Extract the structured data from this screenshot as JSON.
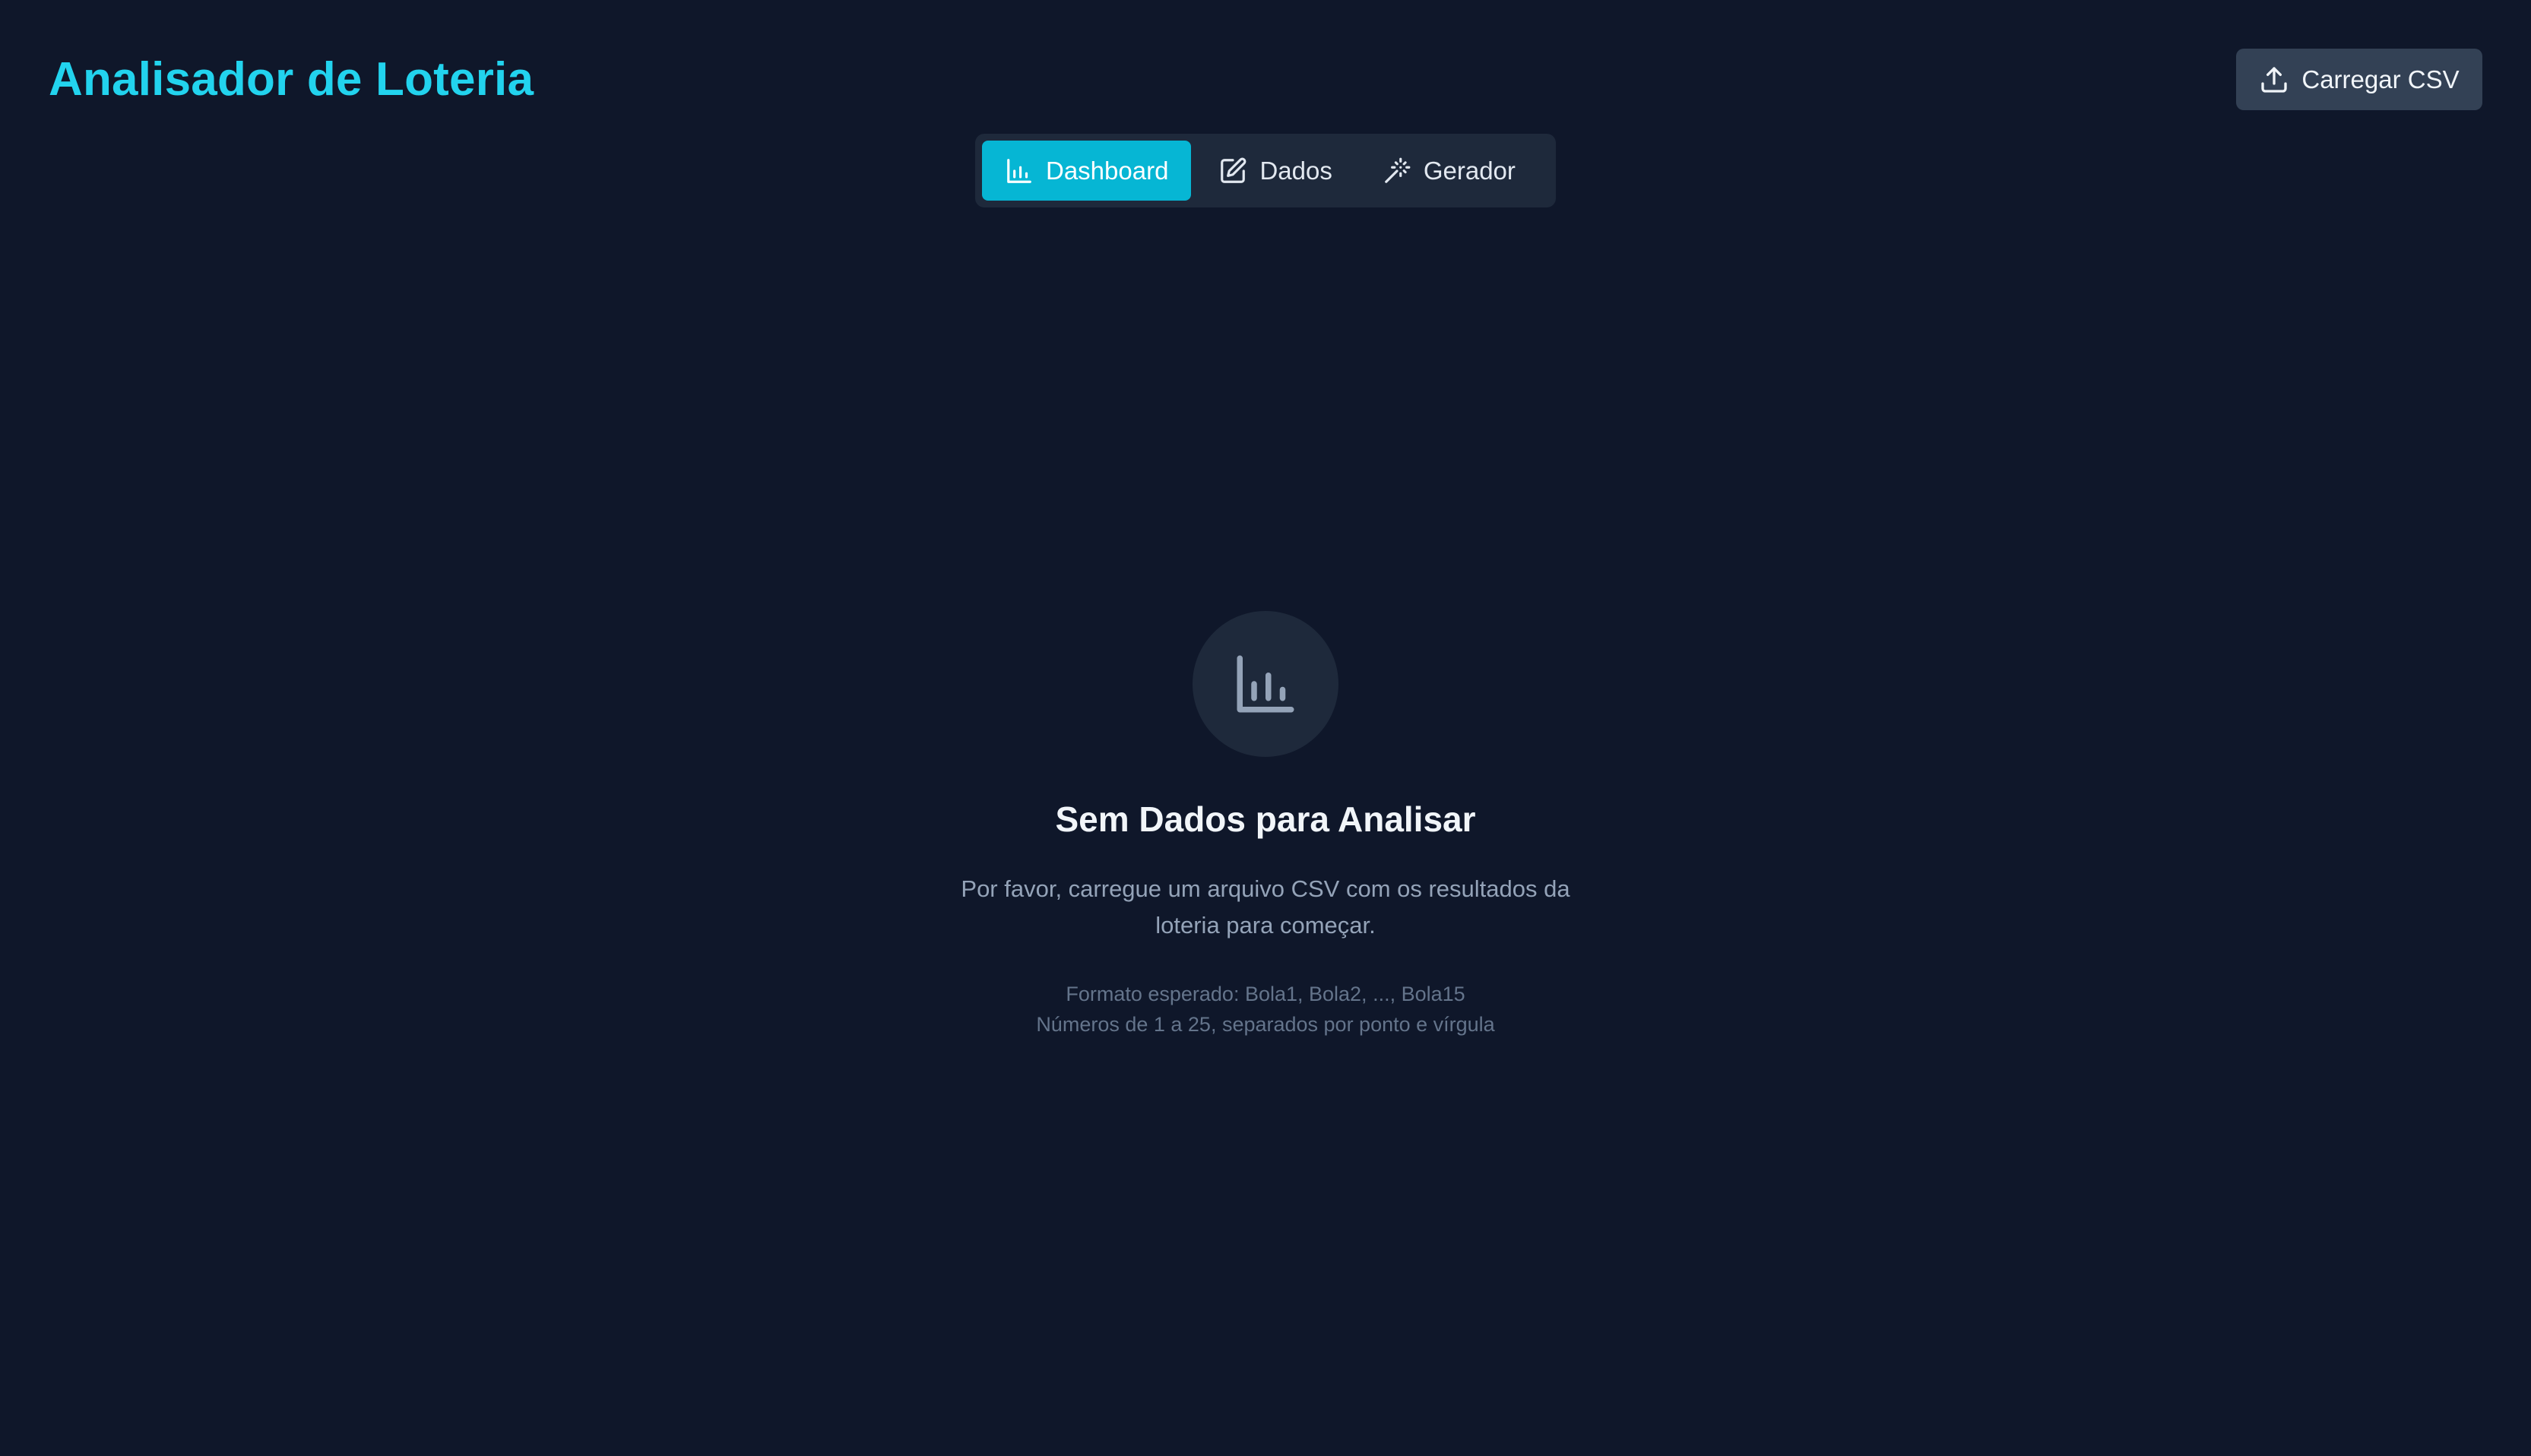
{
  "header": {
    "title": "Analisador de Loteria",
    "upload_label": "Carregar CSV"
  },
  "tabs": [
    {
      "label": "Dashboard",
      "icon": "bar-chart-icon",
      "active": true
    },
    {
      "label": "Dados",
      "icon": "edit-icon",
      "active": false
    },
    {
      "label": "Gerador",
      "icon": "magic-wand-icon",
      "active": false
    }
  ],
  "empty_state": {
    "icon": "bar-chart-icon",
    "title": "Sem Dados para Analisar",
    "description": "Por favor, carregue um arquivo CSV com os resultados da loteria para começar.",
    "format_line1": "Formato esperado: Bola1, Bola2, ..., Bola15",
    "format_line2": "Números de 1 a 25, separados por ponto e vírgula"
  },
  "colors": {
    "background": "#0f172a",
    "accent": "#22d3ee",
    "active_tab": "#06b6d4",
    "surface": "#1e293b",
    "button": "#334155"
  }
}
